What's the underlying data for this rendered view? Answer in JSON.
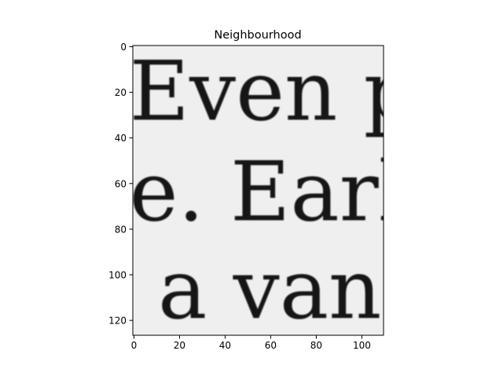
{
  "chart_data": {
    "type": "heatmap",
    "title": "Neighbourhood",
    "xlabel": "",
    "ylabel": "",
    "image_size": {
      "columns": 110,
      "rows": 127
    },
    "xlim": [
      -0.5,
      109.5
    ],
    "ylim": [
      126.5,
      -0.5
    ],
    "x_ticks": [
      0,
      20,
      40,
      60,
      80,
      100
    ],
    "y_ticks": [
      0,
      20,
      40,
      60,
      80,
      100,
      120
    ],
    "grid": false,
    "colormap": "gray",
    "background_color": "#efefef",
    "ink_color": "#141414",
    "image_content": [
      {
        "text": "Even p",
        "baseline_row": 32
      },
      {
        "text": "e. Earl",
        "baseline_row": 76
      },
      {
        "text": "a van",
        "baseline_row": 119
      }
    ]
  }
}
